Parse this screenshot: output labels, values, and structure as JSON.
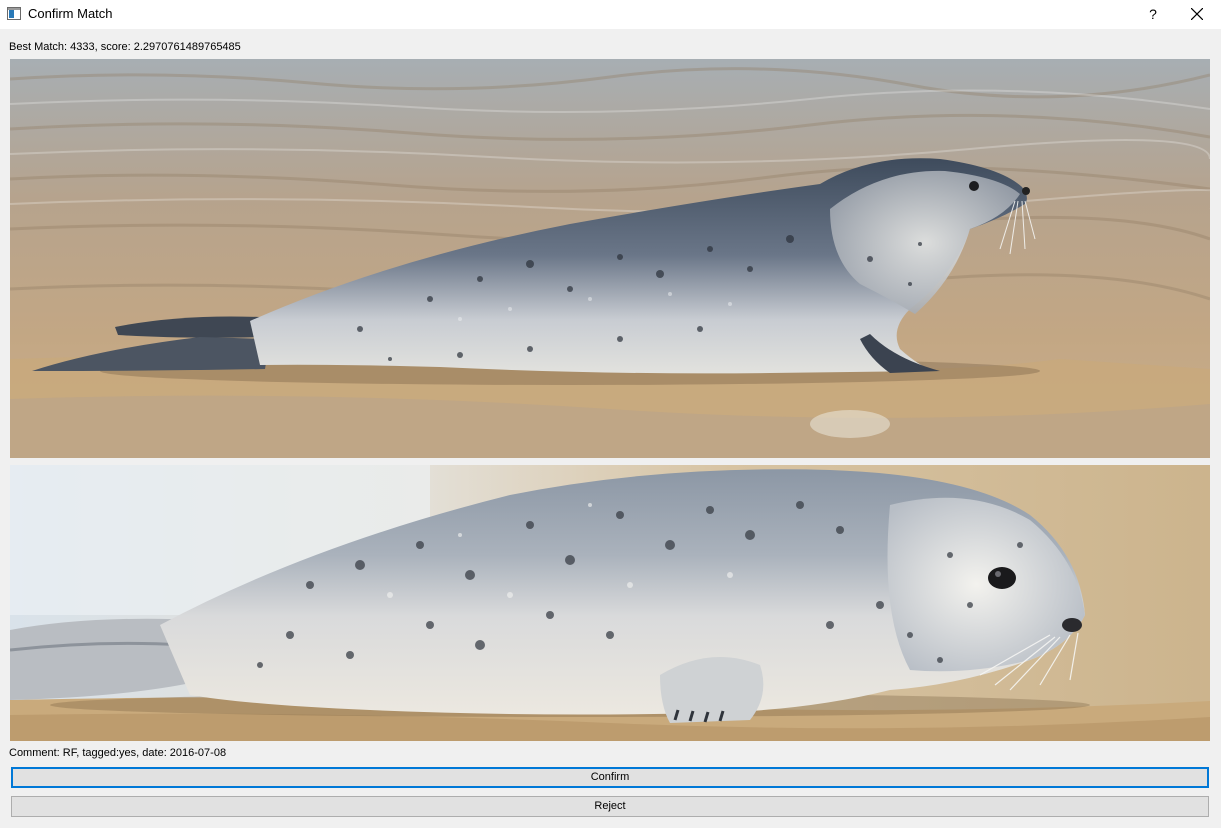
{
  "window": {
    "title": "Confirm Match",
    "help_label": "?"
  },
  "match": {
    "best_match_text": "Best Match: 4333, score: 2.2970761489765485"
  },
  "images": {
    "query_photo": "seal-photo-query",
    "candidate_photo": "seal-photo-candidate"
  },
  "comment": {
    "text": "Comment: RF, tagged:yes, date: 2016-07-08"
  },
  "actions": {
    "confirm_label": "Confirm",
    "reject_label": "Reject"
  },
  "colors": {
    "focus_border": "#0078d7",
    "button_bg": "#e1e1e1",
    "window_bg": "#f0f0f0"
  }
}
